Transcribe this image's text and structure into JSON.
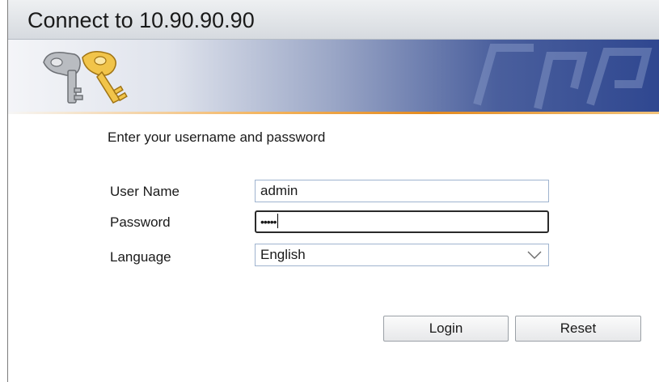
{
  "window": {
    "title": "Connect to 10.90.90.90"
  },
  "banner": {
    "icon": "keys-icon"
  },
  "form": {
    "prompt": "Enter your username and password",
    "username_label": "User Name",
    "username_value": "admin",
    "password_label": "Password",
    "password_masked": "•••••",
    "language_label": "Language",
    "language_value": "English",
    "login_label": "Login",
    "reset_label": "Reset"
  },
  "colors": {
    "banner_dark": "#2f4790",
    "banner_accent": "#e38a1f",
    "field_border": "#9fb4cf"
  }
}
